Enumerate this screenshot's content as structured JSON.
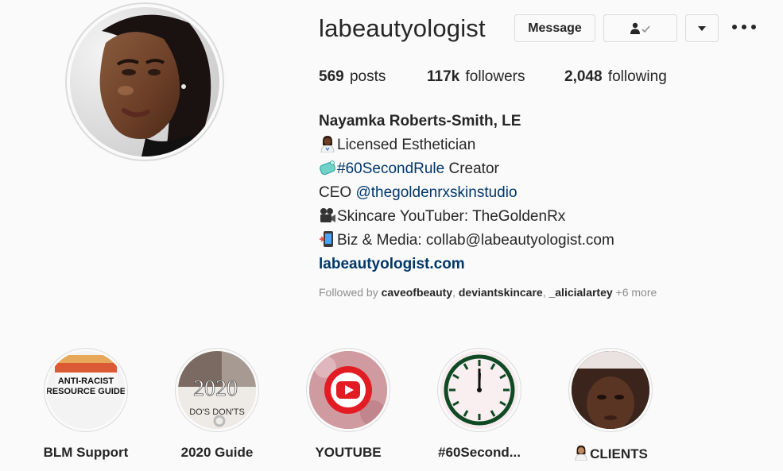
{
  "profile": {
    "username": "labeautyologist",
    "buttons": {
      "message": "Message",
      "dropdown_icon": "chevron-down",
      "more_icon": "more-horizontal"
    },
    "stats": [
      {
        "count": "569",
        "label": "posts"
      },
      {
        "count": "117k",
        "label": "followers"
      },
      {
        "count": "2,048",
        "label": "following"
      }
    ],
    "bio": {
      "name": "Nayamka Roberts-Smith, LE",
      "lines": [
        {
          "emoji": "woman-health-worker",
          "text": "Licensed Esthetician"
        },
        {
          "emoji": "soap",
          "hashtag": "#60SecondRule",
          "text": " Creator"
        },
        {
          "prefix": "CEO ",
          "mention": "@thegoldenrxskinstudio"
        },
        {
          "emoji": "movie-camera",
          "text": "Skincare YouTuber: TheGoldenRx"
        },
        {
          "emoji": "mobile-phone",
          "text": "Biz & Media: collab@labeautyologist.com"
        }
      ],
      "website": "labeautyologist.com"
    },
    "followed_by": {
      "prefix": "Followed by ",
      "users": [
        "caveofbeauty",
        "deviantskincare",
        "_alicialartey"
      ],
      "sep": ", ",
      "more": " +6 more"
    }
  },
  "highlights": [
    {
      "label": "BLM Support",
      "cover_text_1": "ANTI-RACIST",
      "cover_text_2": "RESOURCE GUIDE"
    },
    {
      "label": "2020 Guide",
      "cover_text_1": "2020",
      "cover_text_2": "DO'S DON'TS"
    },
    {
      "label": "YOUTUBE"
    },
    {
      "label": "#60Second..."
    },
    {
      "label": "CLIENTS",
      "emoji": "woman-health-worker"
    }
  ],
  "colors": {
    "link": "#00376b",
    "muted": "#8e8e8e",
    "border": "#dbdbdb",
    "background": "#fafafa",
    "text": "#262626",
    "youtube_red": "#e31b23"
  }
}
